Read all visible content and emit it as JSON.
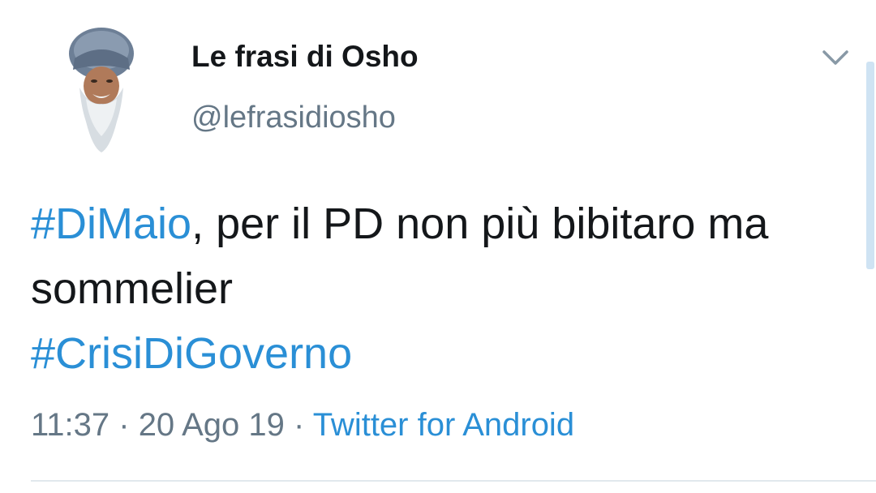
{
  "author": {
    "display_name": "Le frasi di Osho",
    "handle": "@lefrasidiosho",
    "avatar_icon": "bearded-man-avatar"
  },
  "tweet": {
    "hashtag1": "#DiMaio",
    "text_part": ", per il PD non più bibitaro ma sommelier",
    "hashtag2": "#CrisiDiGoverno"
  },
  "meta": {
    "time": "11:37",
    "sep1": " · ",
    "date": "20 Ago 19",
    "sep2": " · ",
    "source": "Twitter for Android"
  },
  "icons": {
    "menu": "chevron-down-icon"
  },
  "colors": {
    "text": "#14171a",
    "secondary": "#657786",
    "link": "#2a8fd6"
  }
}
